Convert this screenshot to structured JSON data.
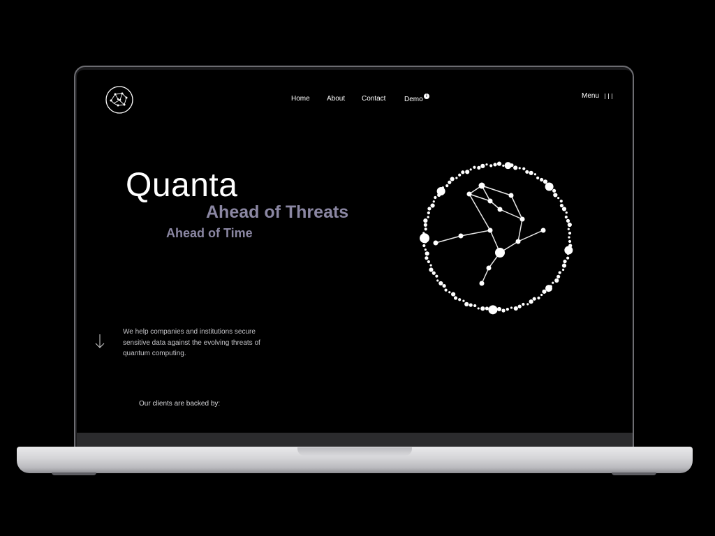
{
  "nav": {
    "home": "Home",
    "about": "About",
    "contact": "Contact",
    "demo": "Demo",
    "demo_badge": "i",
    "menu": "Menu"
  },
  "hero": {
    "title": "Quanta",
    "subtitle_1": "Ahead of Threats",
    "subtitle_2": "Ahead of Time",
    "description": "We help companies and institutions secure sensitive data against the evolving threats of quantum computing."
  },
  "clients": {
    "label": "Our clients are backed by:"
  },
  "icons": {
    "logo": "constellation-logo-icon",
    "menu": "menu-lines-icon",
    "scroll": "arrow-down-icon"
  },
  "colors": {
    "background": "#000000",
    "text": "#ffffff",
    "accent": "#8b87a3",
    "muted": "#c4c4c8"
  }
}
